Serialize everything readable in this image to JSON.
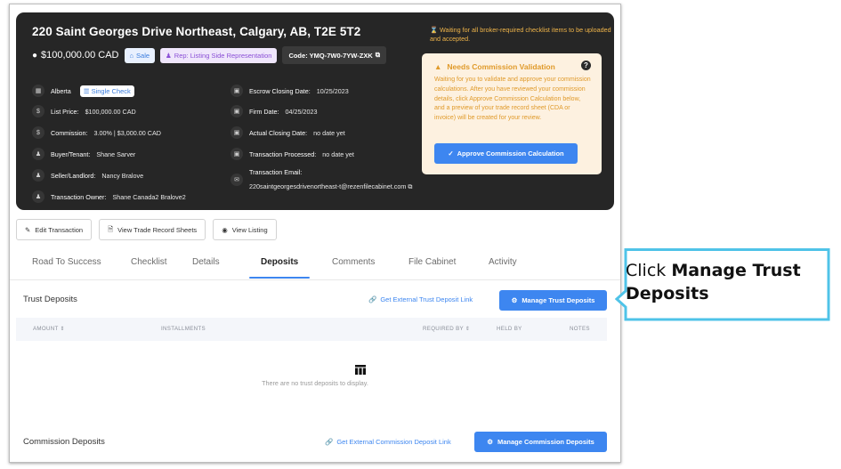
{
  "header": {
    "title": "220 Saint Georges Drive Northeast, Calgary, AB, T2E 5T2",
    "price": "$100,000.00 CAD",
    "badges": {
      "sale": "Sale",
      "rep": "Rep: Listing Side Representation",
      "code": "Code: YMQ-7W0-7YW-ZXK"
    },
    "left_info": [
      {
        "icon": "building-icon",
        "label": "Alberta",
        "value": ""
      },
      {
        "icon": "dollar-icon",
        "label": "List Price:",
        "value": "$100,000.00 CAD"
      },
      {
        "icon": "dollar-icon",
        "label": "Commission:",
        "value": "3.00% | $3,000.00 CAD"
      },
      {
        "icon": "person-icon",
        "label": "Buyer/Tenant:",
        "value": "Shane Sarver"
      },
      {
        "icon": "person-icon",
        "label": "Seller/Landlord:",
        "value": "Nancy Bralove"
      },
      {
        "icon": "person-icon",
        "label": "Transaction Owner:",
        "value": "Shane Canada2 Bralove2"
      }
    ],
    "single_check": "Single Check",
    "right_info": [
      {
        "icon": "calendar-icon",
        "label": "Escrow Closing Date:",
        "value": "10/25/2023"
      },
      {
        "icon": "calendar-icon",
        "label": "Firm Date:",
        "value": "04/25/2023"
      },
      {
        "icon": "calendar-icon",
        "label": "Actual Closing Date:",
        "value": "no date yet"
      },
      {
        "icon": "calendar-icon",
        "label": "Transaction Processed:",
        "value": "no date yet"
      }
    ],
    "email_label": "Transaction Email:",
    "email_value": "220saintgeorgesdrivenortheast-t@rezenfilecabinet.com",
    "waiting_text": "Waiting for all broker-required checklist items to be uploaded and accepted.",
    "commission_validation": {
      "title": "Needs Commission Validation",
      "text": "Waiting for you to validate and approve your commission calculations. After you have reviewed your commission details, click Approve Commission Calculation below, and a preview of your trade record sheet (CDA or invoice) will be created for your review.",
      "button": "Approve Commission Calculation"
    }
  },
  "actions": {
    "edit": "Edit Transaction",
    "trade_record": "View Trade Record Sheets",
    "listing": "View Listing"
  },
  "tabs": [
    {
      "label": "Road To Success",
      "active": false
    },
    {
      "label": "Checklist",
      "active": false
    },
    {
      "label": "Details",
      "active": false
    },
    {
      "label": "Deposits",
      "active": true
    },
    {
      "label": "Comments",
      "active": false
    },
    {
      "label": "File Cabinet",
      "active": false
    },
    {
      "label": "Activity",
      "active": false
    }
  ],
  "trust": {
    "title": "Trust Deposits",
    "link": "Get External Trust Deposit Link",
    "button": "Manage Trust Deposits",
    "columns": [
      "AMOUNT",
      "INSTALLMENTS",
      "REQUIRED BY",
      "HELD BY",
      "NOTES"
    ],
    "empty": "There are no trust deposits to display."
  },
  "commission": {
    "title": "Commission Deposits",
    "link": "Get External Commission Deposit Link",
    "button": "Manage Commission Deposits"
  },
  "callout": {
    "prefix": "Click ",
    "bold": "Manage Trust Deposits",
    "border_color": "#4fc3e8"
  },
  "colors": {
    "primary": "#3d86f0",
    "hero_bg": "#262626",
    "warning": "#e09a2a"
  }
}
